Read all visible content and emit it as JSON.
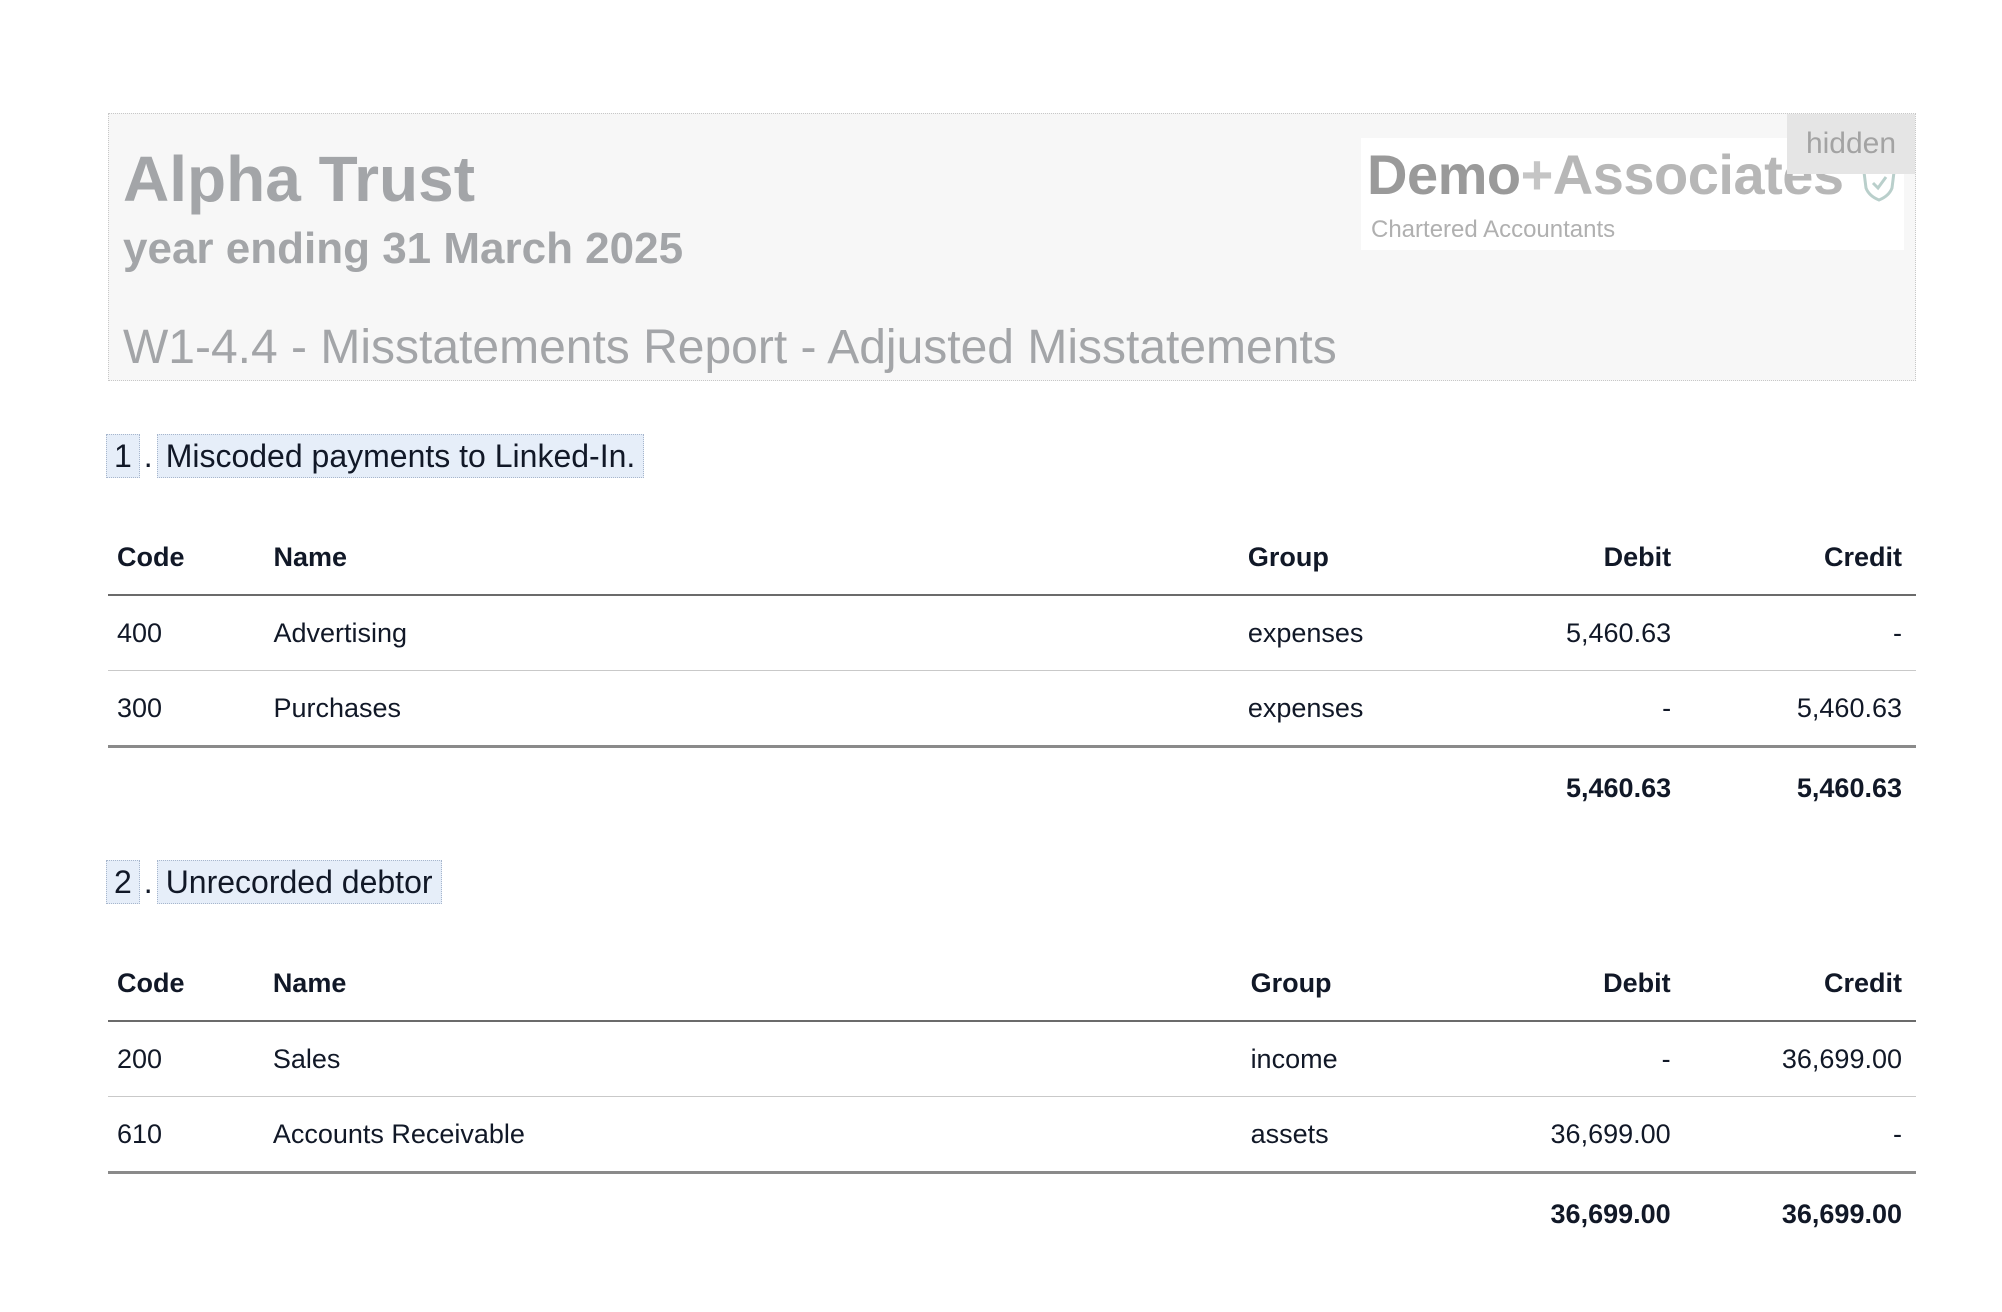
{
  "header": {
    "entity": "Alpha Trust",
    "period": "year ending 31 March 2025",
    "report_title": "W1-4.4 - Misstatements Report - Adjusted Misstatements",
    "logo": {
      "name_part1": "Demo",
      "name_plus": "+",
      "name_part2": "Associates",
      "tagline": "Chartered Accountants",
      "icon": "shield-icon"
    },
    "hidden_badge": "hidden"
  },
  "columns": {
    "code": "Code",
    "name": "Name",
    "group": "Group",
    "debit": "Debit",
    "credit": "Credit"
  },
  "misstatements": [
    {
      "number": "1",
      "separator": ".",
      "title": "Miscoded payments to Linked-In.",
      "rows": [
        {
          "code": "400",
          "name": "Advertising",
          "group": "expenses",
          "debit": "5,460.63",
          "credit": "-"
        },
        {
          "code": "300",
          "name": "Purchases",
          "group": "expenses",
          "debit": "-",
          "credit": "5,460.63"
        }
      ],
      "total_debit": "5,460.63",
      "total_credit": "5,460.63"
    },
    {
      "number": "2",
      "separator": ".",
      "title": "Unrecorded debtor",
      "rows": [
        {
          "code": "200",
          "name": "Sales",
          "group": "income",
          "debit": "-",
          "credit": "36,699.00"
        },
        {
          "code": "610",
          "name": "Accounts Receivable",
          "group": "assets",
          "debit": "36,699.00",
          "credit": "-"
        }
      ],
      "total_debit": "36,699.00",
      "total_credit": "36,699.00"
    }
  ]
}
